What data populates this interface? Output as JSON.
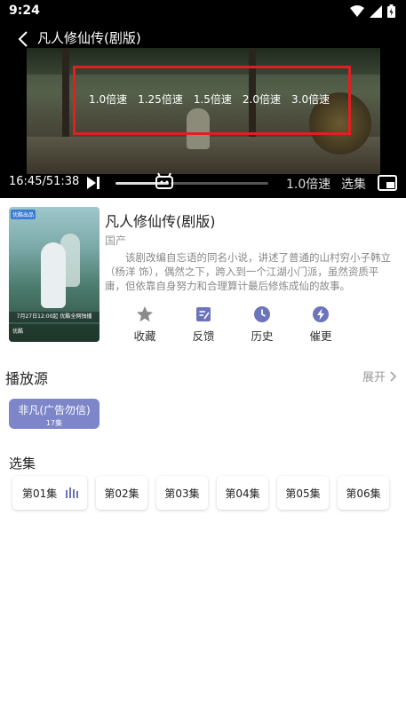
{
  "status_bar": {
    "time": "9:24"
  },
  "player": {
    "title": "凡人修仙传(剧版)",
    "speed_options": [
      "1.0倍速",
      "1.25倍速",
      "1.5倍速",
      "2.0倍速",
      "3.0倍速"
    ],
    "time_display": "16:45/51:38",
    "progress_fraction": 0.325,
    "speed_label": "1.0倍速",
    "episodes_label": "选集"
  },
  "drama": {
    "title": "凡人修仙传(剧版)",
    "region": "国产",
    "synopsis": "该剧改编自忘语的同名小说，讲述了普通的山村穷小子韩立（杨洋 饰），偶然之下，跨入到一个江湖小门派，虽然资质平庸，但依靠自身努力和合理算计最后修炼成仙的故事。",
    "poster_text": {
      "tag": "优酷出品",
      "banner": "7月27日12:00起 优酷全网独播",
      "brand": "优酷"
    },
    "actions": [
      {
        "label": "收藏",
        "icon": "star-icon"
      },
      {
        "label": "反馈",
        "icon": "feedback-icon"
      },
      {
        "label": "历史",
        "icon": "clock-icon"
      },
      {
        "label": "催更",
        "icon": "lightning-icon"
      }
    ]
  },
  "sources": {
    "title": "播放源",
    "expand_label": "展开",
    "items": [
      {
        "name": "非凡(广告勿信)",
        "count": "17集"
      }
    ]
  },
  "episodes": {
    "title": "选集",
    "items": [
      "第01集",
      "第02集",
      "第03集",
      "第04集",
      "第05集",
      "第06集"
    ]
  },
  "colors": {
    "accent": "#7d86c9",
    "icon_blue": "#6b74bd",
    "highlight_box": "#e02020"
  }
}
